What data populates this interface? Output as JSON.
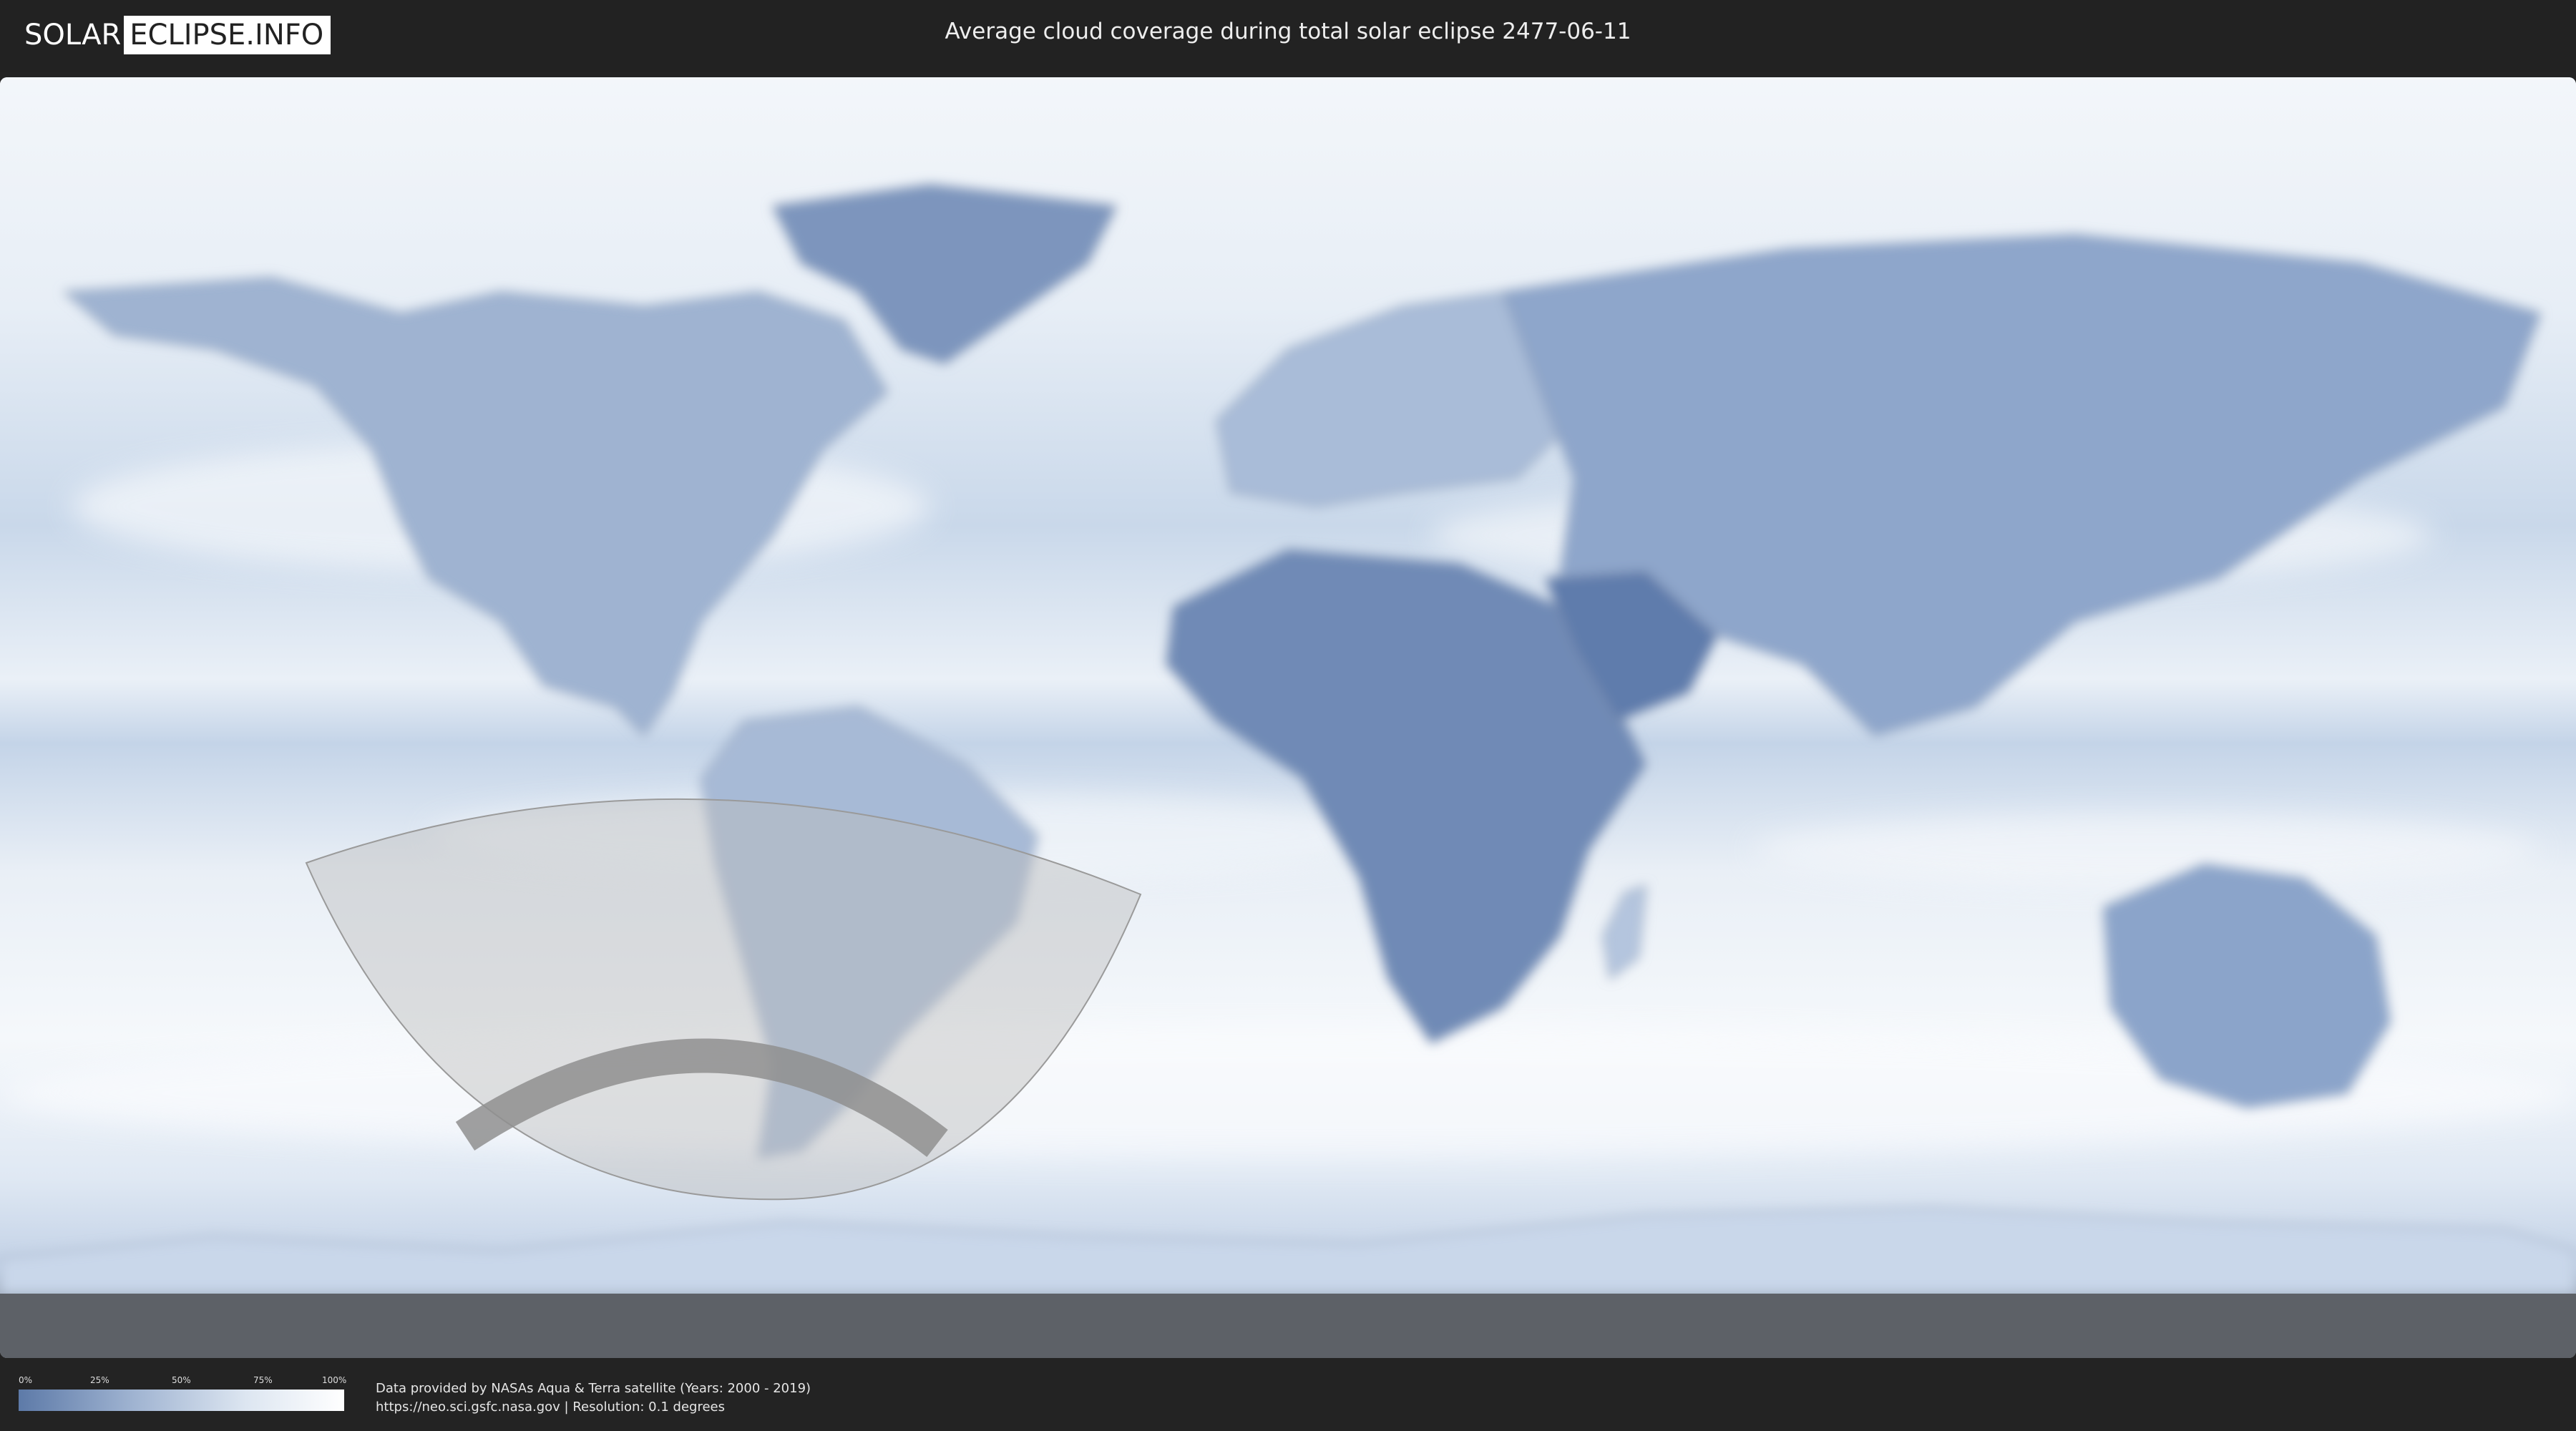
{
  "header": {
    "logo_left": "SOLAR",
    "logo_right": "ECLIPSE.INFO",
    "title": "Average cloud coverage during total solar eclipse 2477-06-11"
  },
  "map": {
    "projection": "equirectangular",
    "base_colors": {
      "clear": "#5d7aa8",
      "cloudy": "#ffffff",
      "land_outline": "#8a98ad"
    },
    "eclipse_path_color": "#8f8f8f",
    "visibility_zone_color": "#bdbdbd"
  },
  "legend": {
    "ticks": [
      "0%",
      "25%",
      "50%",
      "75%",
      "100%"
    ],
    "gradient": [
      "#5d7aa8",
      "#9fb3d1",
      "#dde6f1",
      "#ffffff"
    ]
  },
  "credits": {
    "line1": "Data provided by NASAs Aqua & Terra satellite (Years: 2000 - 2019)",
    "line2": "https://neo.sci.gsfc.nasa.gov | Resolution: 0.1 degrees"
  }
}
